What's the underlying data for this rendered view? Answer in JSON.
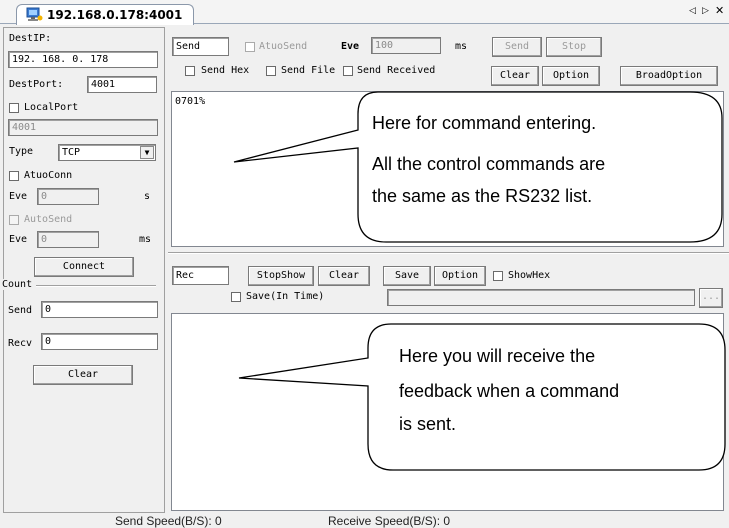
{
  "tab": {
    "title": "192.168.0.178:4001"
  },
  "window_controls": {
    "prev": "◁",
    "next": "▷",
    "close": "✕"
  },
  "left": {
    "destip_label": "DestIP:",
    "destip_value": "192. 168. 0. 178",
    "destport_label": "DestPort:",
    "destport_value": "4001",
    "localport_label": "LocalPort",
    "localport_value": "4001",
    "type_label": "Type",
    "type_value": "TCP",
    "autoconn_label": "AtuoConn",
    "eve1_label": "Eve",
    "eve1_value": "0",
    "eve1_unit": "s",
    "autosend_label": "AutoSend",
    "eve2_label": "Eve",
    "eve2_value": "0",
    "eve2_unit": "ms",
    "connect_label": "Connect",
    "count_label": "Count",
    "send_label": "Send",
    "send_value": "0",
    "recv_label": "Recv",
    "recv_value": "0",
    "clear_label": "Clear"
  },
  "send": {
    "send_label": "Send",
    "autosend_label": "AtuoSend",
    "eve_label": "Eve",
    "eve_value": "100",
    "eve_unit": "ms",
    "send_btn": "Send",
    "stop_btn": "Stop",
    "send_hex": "Send Hex",
    "send_file": "Send File",
    "send_received": "Send Received",
    "clear_btn": "Clear",
    "option_btn": "Option",
    "broadoption_btn": "BroadOption",
    "text": "0701%"
  },
  "recv": {
    "rec_label": "Rec",
    "stopshow_btn": "StopShow",
    "clear_btn": "Clear",
    "save_btn": "Save",
    "option_btn": "Option",
    "showhex_label": "ShowHex",
    "save_in_time": "Save(In Time)",
    "browse_btn": "..."
  },
  "callouts": {
    "top_line1": "Here for command entering.",
    "top_line2": "All the control commands are",
    "top_line3": "the same as the RS232 list.",
    "bottom_line1": "Here you will receive the",
    "bottom_line2": "feedback when a command",
    "bottom_line3": "is sent."
  },
  "status": {
    "send_speed": "Send Speed(B/S): 0",
    "receive_speed": "Receive Speed(B/S): 0"
  }
}
